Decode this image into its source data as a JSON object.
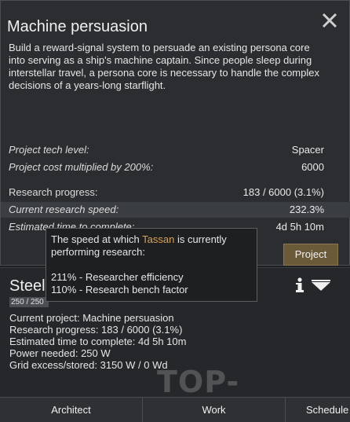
{
  "window": {
    "title": "Machine persuasion",
    "description": "Build a reward-signal system to persuade an existing persona core into serving as a ship's machine captain. Since people sleep during interstellar travel, a persona core is necessary to handle the complex decisions of a years-long starflight.",
    "rows": [
      {
        "label": "Project tech level:",
        "value": "Spacer"
      },
      {
        "label": "Project cost multiplied by 200%:",
        "value": "6000"
      },
      {
        "label": "Research progress:",
        "value": "183 / 6000 (3.1%)"
      },
      {
        "label": "Current research speed:",
        "value": "232.3%"
      },
      {
        "label": "Estimated time to complete:",
        "value": "4d 5h 10m"
      }
    ],
    "project_button": "Project"
  },
  "tooltip": {
    "line1_prefix": "The speed at which",
    "name": "Tassan",
    "line1_suffix": "is currently",
    "line2": "performing research:",
    "factor1": "211% - Researcher efficiency",
    "factor2": "110% - Research bench factor"
  },
  "inspect": {
    "title": "Steel",
    "hp_text": "250 / 250",
    "hp_fraction": 1.0,
    "lines": [
      "Current project: Machine persuasion",
      "Research progress: 183 / 6000 (3.1%)",
      "Estimated time to complete: 4d 5h 10m",
      "Power needed: 250 W",
      "Grid excess/stored: 3150 W / 0 Wd"
    ]
  },
  "bottom_tabs": [
    "Architect",
    "Work",
    "Schedule"
  ],
  "watermark": "TOP-MODS.RU",
  "colors": {
    "accent": "#d7a25c",
    "button": "#6b5a3a"
  },
  "icons": [
    "close-icon",
    "info-icon",
    "rename-icon"
  ]
}
